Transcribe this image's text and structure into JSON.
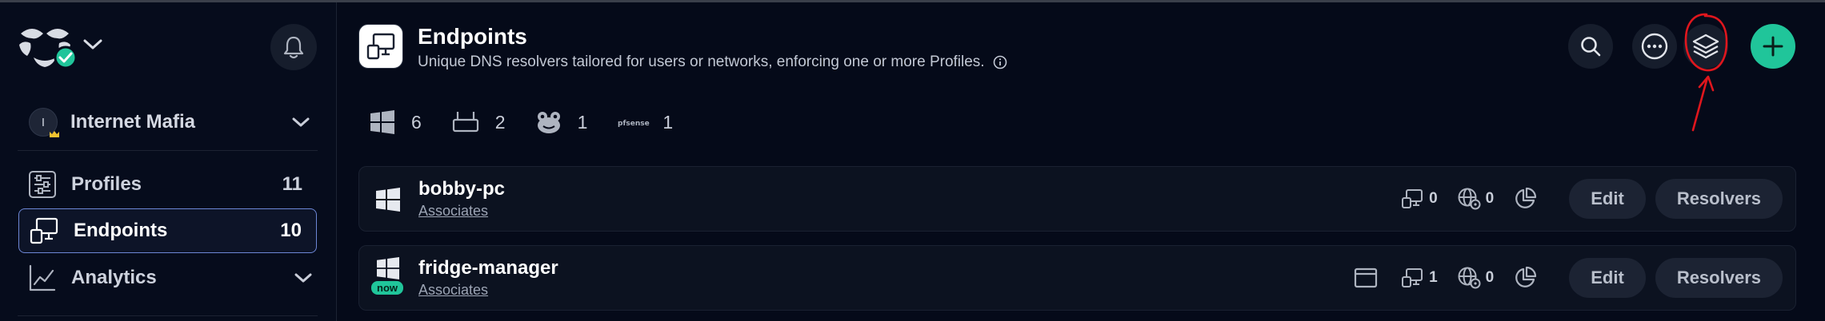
{
  "org": {
    "avatar_initial": "I",
    "name": "Internet Mafia"
  },
  "sidebar": {
    "items": [
      {
        "label": "Profiles",
        "count": "11"
      },
      {
        "label": "Endpoints",
        "count": "10"
      },
      {
        "label": "Analytics",
        "count": ""
      }
    ]
  },
  "page": {
    "title": "Endpoints",
    "subtitle": "Unique DNS resolvers tailored for users or networks, enforcing one or more Profiles."
  },
  "stats": [
    {
      "icon": "windows-icon",
      "count": "6"
    },
    {
      "icon": "router-icon",
      "count": "2"
    },
    {
      "icon": "frog-icon",
      "count": "1"
    },
    {
      "icon": "pfsense-icon",
      "count": "1",
      "logo_text": "pfsense"
    }
  ],
  "endpoints": [
    {
      "name": "bobby-pc",
      "profile": "Associates",
      "os_icon": "windows-icon",
      "badge": "",
      "devices": "0",
      "networks": "0",
      "edit_label": "Edit",
      "resolvers_label": "Resolvers"
    },
    {
      "name": "fridge-manager",
      "profile": "Associates",
      "os_icon": "windows-icon",
      "badge": "now",
      "devices": "1",
      "networks": "0",
      "edit_label": "Edit",
      "resolvers_label": "Resolvers"
    }
  ],
  "colors": {
    "background": "#050a19",
    "accent": "#20c59a",
    "active_border": "#6d87d6",
    "annotation": "#e0161d"
  }
}
